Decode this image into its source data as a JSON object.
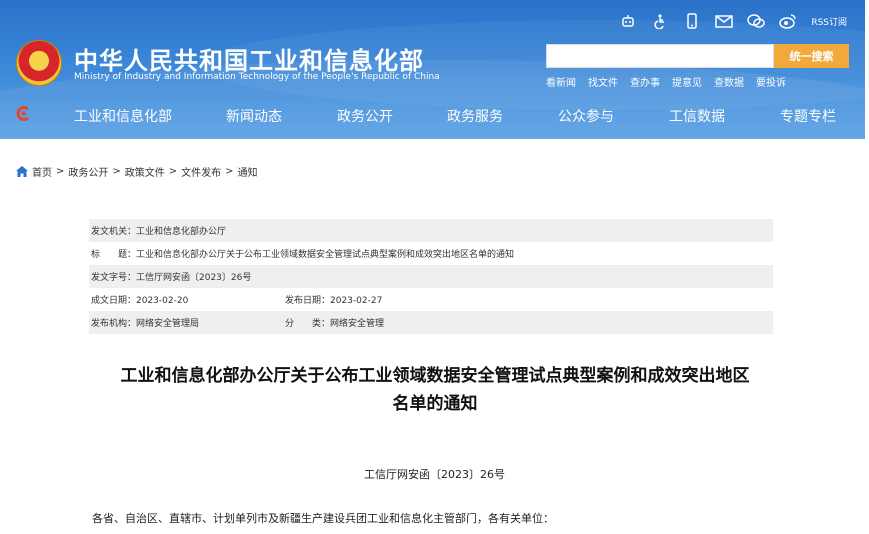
{
  "header": {
    "title": "中华人民共和国工业和信息化部",
    "subtitle": "Ministry of Industry and Information Technology of the People's Republic of China",
    "top_icons": [
      "robot-icon",
      "accessibility-icon",
      "mobile-icon",
      "mail-icon",
      "wechat-icon",
      "weibo-icon"
    ],
    "rss_label": "RSS订阅",
    "search": {
      "placeholder": "",
      "button_label": "统一搜索"
    },
    "quick_links": [
      "看新闻",
      "找文件",
      "查办事",
      "提意见",
      "查数据",
      "要投诉"
    ],
    "nav": [
      "工业和信息化部",
      "新闻动态",
      "政务公开",
      "政务服务",
      "公众参与",
      "工信数据",
      "专题专栏"
    ],
    "colors": {
      "banner": "#3a86d8",
      "search_button": "#f1a93b"
    }
  },
  "breadcrumb": [
    "首页",
    "政务公开",
    "政策文件",
    "文件发布",
    "通知"
  ],
  "meta": {
    "issuer": "发文机关：工业和信息化部办公厅",
    "subject": "标　　题：工业和信息化部办公厅关于公布工业领域数据安全管理试点典型案例和成效突出地区名单的通知",
    "doc_number": "发文字号：工信厅网安函〔2023〕26号",
    "date_created": "成文日期：2023-02-20",
    "date_published": "发布日期：2023-02-27",
    "department": "发布机构：网络安全管理局",
    "category": "分　　类：网络安全管理"
  },
  "article": {
    "title_line1": "工业和信息化部办公厅关于公布工业领域数据安全管理试点典型案例和成效突出地区",
    "title_line2": "名单的通知",
    "doc_number": "工信厅网安函〔2023〕26号",
    "salutation": "各省、自治区、直辖市、计划单列市及新疆生产建设兵团工业和信息化主管部门，各有关单位："
  }
}
